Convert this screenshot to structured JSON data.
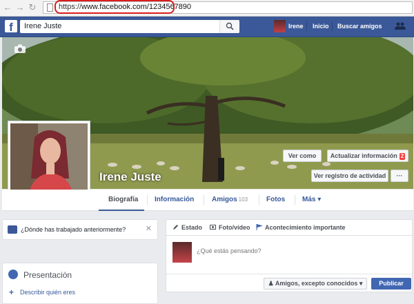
{
  "browser": {
    "url_scheme": "https://",
    "url_host": "www.facebook.com/1234567890"
  },
  "topbar": {
    "search_value": "Irene Juste",
    "user_name": "Irene",
    "home_label": "Inicio",
    "find_friends_label": "Buscar amigos"
  },
  "profile": {
    "name": "Irene Juste",
    "view_as_label": "Ver como",
    "update_info_label": "Actualizar información",
    "update_info_badge": "2",
    "activity_log_label": "Ver registro de actividad",
    "more_label": "···"
  },
  "tabs": [
    {
      "label": "Biografía"
    },
    {
      "label": "Información"
    },
    {
      "label": "Amigos",
      "count": "103"
    },
    {
      "label": "Fotos"
    },
    {
      "label": "Más ▾"
    }
  ],
  "work_prompt": {
    "text": "¿Dónde has trabajado anteriormente?",
    "close": "✕"
  },
  "intro": {
    "title": "Presentación",
    "link": "Describir quién eres"
  },
  "composer": {
    "tab_status": "Estado",
    "tab_photo": "Foto/vídeo",
    "tab_event": "Acontecimiento importante",
    "placeholder": "¿Qué estás pensando?",
    "audience": "Amigos, excepto conocidos",
    "publish": "Publicar"
  },
  "colors": {
    "fb_blue": "#3b5998",
    "link_blue": "#365899",
    "publish_blue": "#4267b2",
    "badge_red": "#fa3e3e",
    "url_highlight_red": "#d81c1c"
  }
}
